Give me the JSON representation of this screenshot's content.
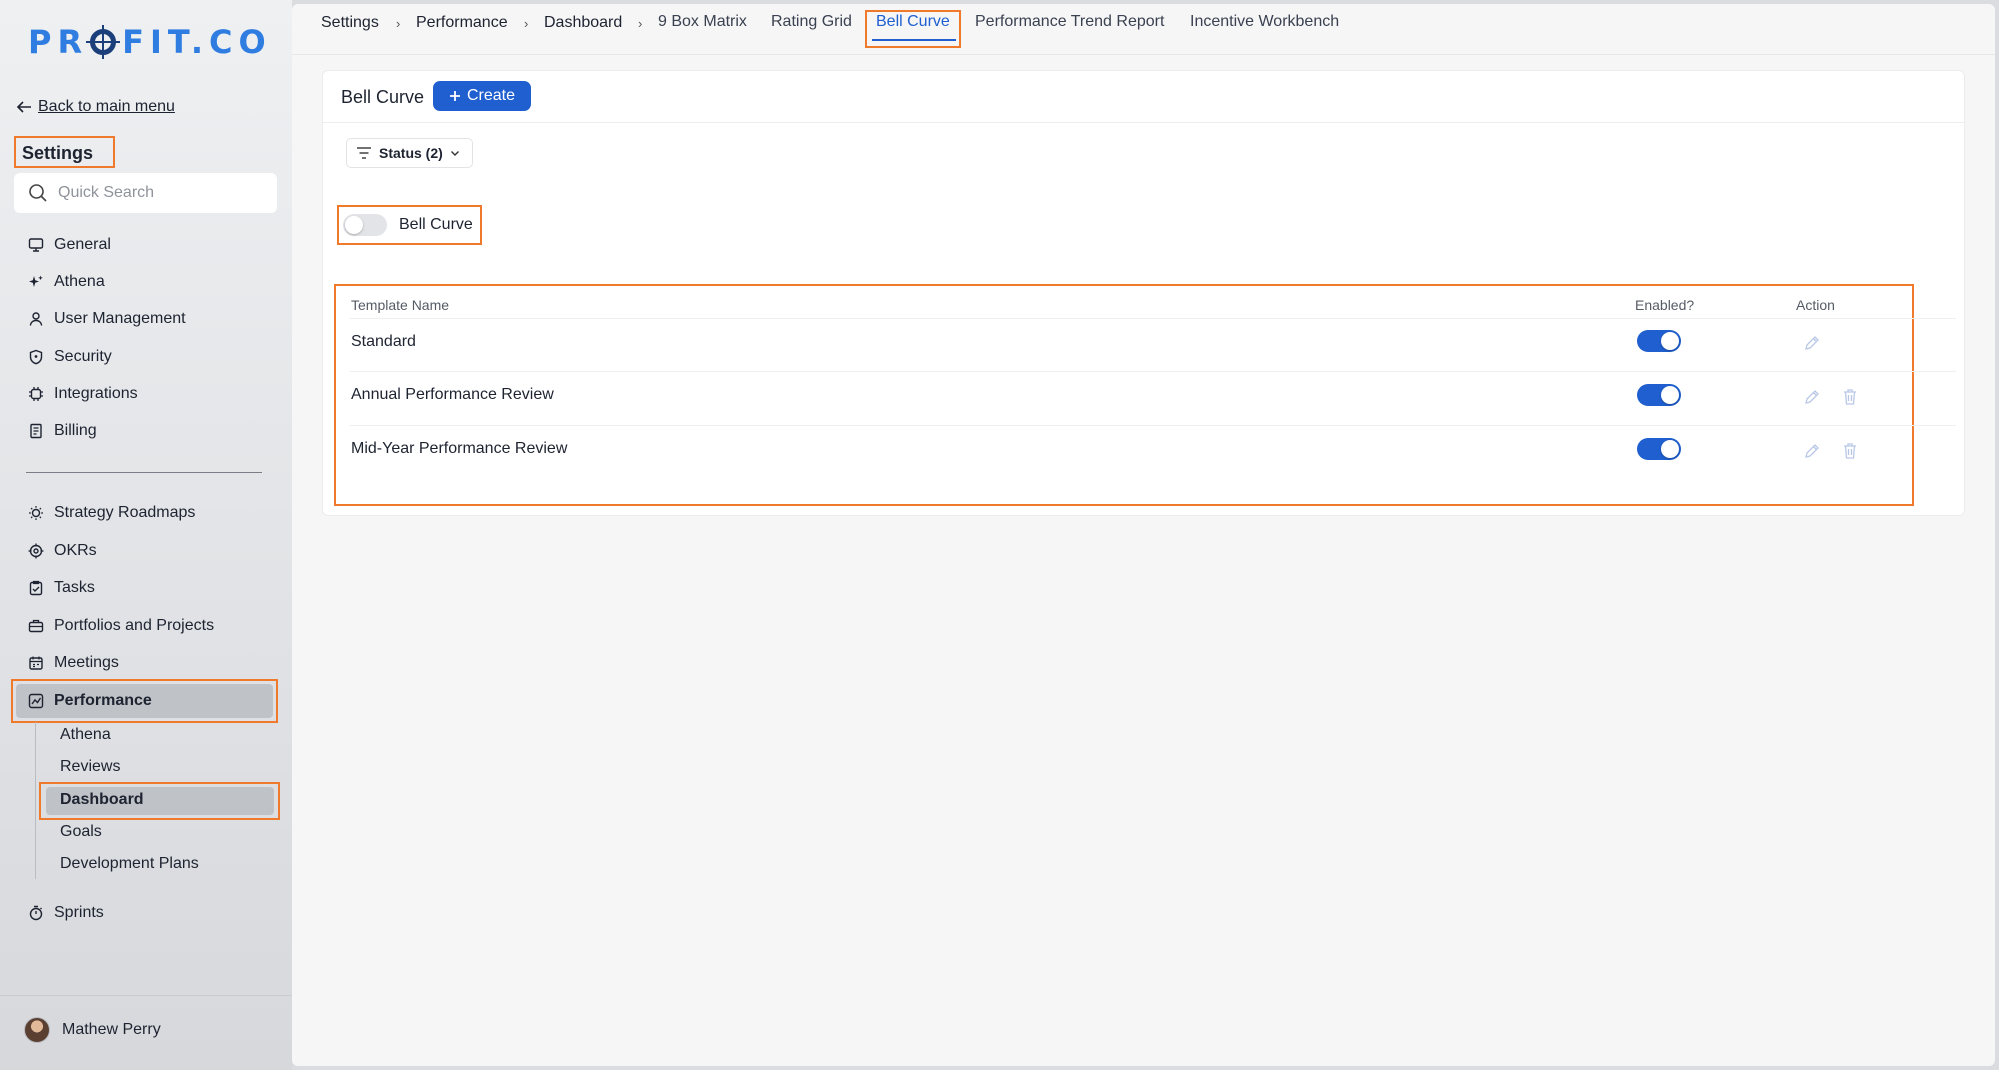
{
  "brand": {
    "logo_left": "PR",
    "logo_right": "FIT.CO"
  },
  "sidebar": {
    "back_label": "Back to main menu",
    "title": "Settings",
    "search_placeholder": "Quick Search",
    "primary_items": [
      {
        "label": "General",
        "icon": "monitor-icon"
      },
      {
        "label": "Athena",
        "icon": "sparkle-icon"
      },
      {
        "label": "User Management",
        "icon": "user-icon"
      },
      {
        "label": "Security",
        "icon": "shield-icon"
      },
      {
        "label": "Integrations",
        "icon": "chip-icon"
      },
      {
        "label": "Billing",
        "icon": "receipt-icon"
      }
    ],
    "module_items": [
      {
        "label": "Strategy Roadmaps",
        "icon": "bulb-icon"
      },
      {
        "label": "OKRs",
        "icon": "target-icon"
      },
      {
        "label": "Tasks",
        "icon": "clipboard-check-icon"
      },
      {
        "label": "Portfolios and Projects",
        "icon": "briefcase-icon"
      },
      {
        "label": "Meetings",
        "icon": "calendar-icon"
      },
      {
        "label": "Performance",
        "icon": "chart-line-icon",
        "active": true
      }
    ],
    "performance_sub": [
      "Athena",
      "Reviews",
      "Dashboard",
      "Goals",
      "Development Plans"
    ],
    "active_sub": "Dashboard",
    "after_items": [
      {
        "label": "Sprints",
        "icon": "stopwatch-icon"
      }
    ],
    "user": {
      "name": "Mathew Perry"
    }
  },
  "topbar": {
    "breadcrumb": [
      "Settings",
      "Performance",
      "Dashboard"
    ],
    "tabs": [
      "9 Box Matrix",
      "Rating Grid",
      "Bell Curve",
      "Performance Trend Report",
      "Incentive Workbench"
    ],
    "active_tab": "Bell Curve"
  },
  "card": {
    "title": "Bell Curve",
    "create_label": "Create",
    "filter_label": "Status (2)",
    "bell_toggle": {
      "label": "Bell Curve",
      "on": false
    },
    "table": {
      "headers": [
        "Template Name",
        "Enabled?",
        "Action"
      ],
      "rows": [
        {
          "name": "Standard",
          "enabled": true,
          "deletable": false
        },
        {
          "name": "Annual Performance Review",
          "enabled": true,
          "deletable": true
        },
        {
          "name": "Mid-Year Performance Review",
          "enabled": true,
          "deletable": true
        }
      ]
    }
  },
  "colors": {
    "accent": "#1f5fcf",
    "highlight": "#f07a2c",
    "logo_blue": "#2f7de1"
  }
}
